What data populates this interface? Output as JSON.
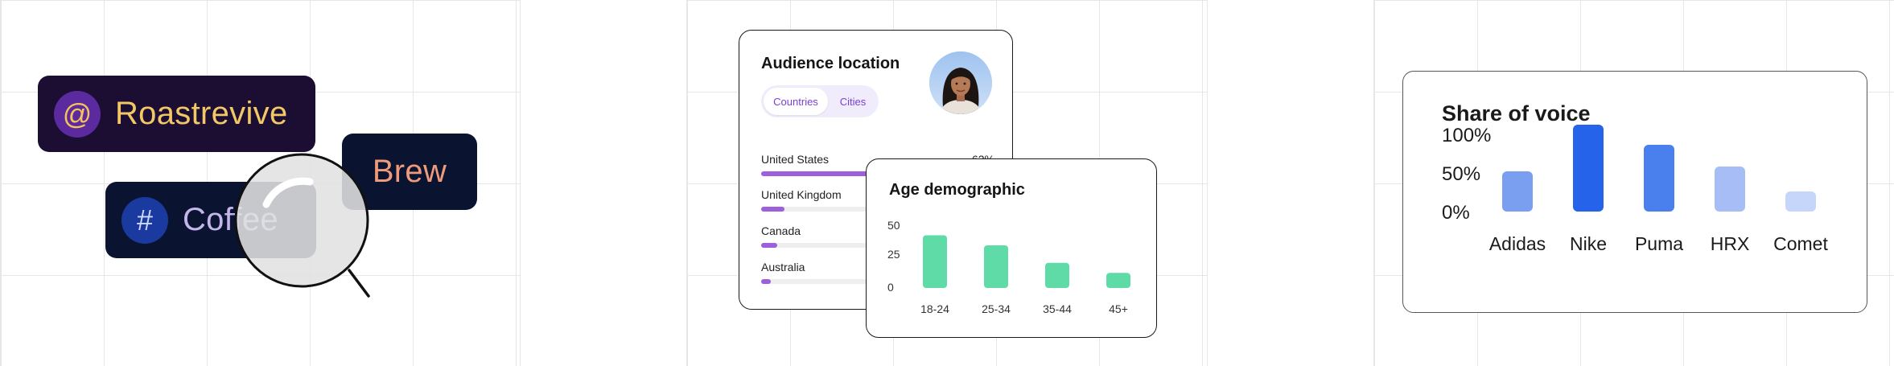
{
  "hashtags": {
    "roast": {
      "symbol": "@",
      "label": "Roastrevive"
    },
    "coffee": {
      "symbol": "#",
      "label": "Coffee"
    },
    "brew": {
      "label": "Brew"
    },
    "colors": {
      "roast_bg": "#1c0d33",
      "navy_bg": "#0a1330",
      "gold": "#f1c865",
      "lavender": "#c4b6ea",
      "coral": "#ef9a7a"
    }
  },
  "audience": {
    "title": "Audience location",
    "tabs": [
      {
        "label": "Countries",
        "active": true
      },
      {
        "label": "Cities",
        "active": false
      }
    ],
    "avatar_icon": "user-avatar-photo",
    "rows": [
      {
        "name": "United States",
        "percent": "62%",
        "fill": 0.62
      },
      {
        "name": "United Kingdom",
        "percent": "",
        "fill": 0.1
      },
      {
        "name": "Canada",
        "percent": "",
        "fill": 0.07
      },
      {
        "name": "Australia",
        "percent": "",
        "fill": 0.04
      }
    ],
    "bar_color": "#9d5fdc"
  },
  "age": {
    "title": "Age demographic",
    "bar_color": "#5fdba7",
    "chart_data": {
      "type": "bar",
      "title": "Age demographic",
      "categories": [
        "18-24",
        "25-34",
        "35-44",
        "45+"
      ],
      "values": [
        42,
        34,
        20,
        12
      ],
      "ylim": [
        0,
        50
      ],
      "y_ticks": [
        "50",
        "25",
        "0"
      ]
    }
  },
  "voice": {
    "title": "Share of voice",
    "chart_data": {
      "type": "bar",
      "title": "Share of voice",
      "categories": [
        "Adidas",
        "Nike",
        "Puma",
        "HRX",
        "Comet"
      ],
      "values": [
        0.5,
        1.08,
        0.83,
        0.56,
        0.25
      ],
      "colors": [
        "#7a9ef0",
        "#2563eb",
        "#4a80ee",
        "#a6bdf5",
        "#c6d6fa"
      ],
      "ylim": [
        0,
        1
      ],
      "y_ticks": [
        "100%",
        "50%",
        "0%"
      ]
    }
  }
}
